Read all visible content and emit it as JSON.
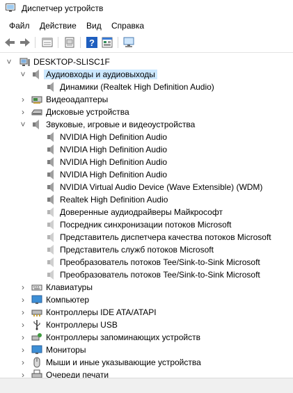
{
  "window": {
    "title": "Диспетчер устройств"
  },
  "menu": {
    "items": [
      {
        "label": "Файл"
      },
      {
        "label": "Действие"
      },
      {
        "label": "Вид"
      },
      {
        "label": "Справка"
      }
    ]
  },
  "toolbar": {
    "buttons": [
      "back-icon",
      "forward-icon",
      "properties-icon",
      "update-driver-icon",
      "help-icon",
      "view-icon",
      "monitor-scan-icon"
    ]
  },
  "tree": {
    "root": "DESKTOP-SLISC1F",
    "categories": {
      "audio_io": "Аудиовходы и аудиовыходы",
      "video_adapters": "Видеоадаптеры",
      "disk_devices": "Дисковые устройства",
      "sound_devices": "Звуковые, игровые и видеоустройства",
      "keyboards": "Клавиатуры",
      "computer": "Компьютер",
      "ide_controllers": "Контроллеры IDE ATA/ATAPI",
      "usb_controllers": "Контроллеры USB",
      "storage_controllers": "Контроллеры запоминающих устройств",
      "monitors": "Мониторы",
      "mice": "Мыши и иные указывающие устройства",
      "print_queues": "Очереди печати"
    },
    "audio_io_children": [
      "Динамики (Realtek High Definition Audio)"
    ],
    "sound_children": [
      "NVIDIA High Definition Audio",
      "NVIDIA High Definition Audio",
      "NVIDIA High Definition Audio",
      "NVIDIA High Definition Audio",
      "NVIDIA Virtual Audio Device (Wave Extensible) (WDM)",
      "Realtek High Definition Audio",
      "Доверенные аудиодрайверы Майкрософт",
      "Посредник синхронизации потоков Microsoft",
      "Представитель диспетчера качества потоков Microsoft",
      "Представитель служб потоков Microsoft",
      "Преобразователь потоков Tee/Sink-to-Sink Microsoft",
      "Преобразователь потоков Tee/Sink-to-Sink Microsoft"
    ]
  }
}
